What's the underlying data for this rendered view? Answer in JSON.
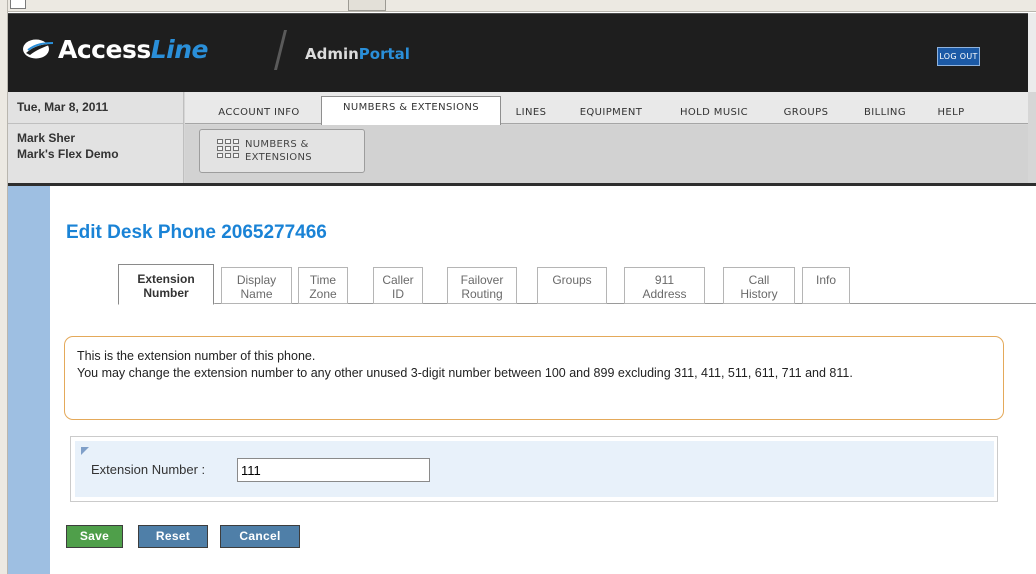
{
  "header": {
    "logo_access": "Access",
    "logo_line": "Line",
    "portal_admin": "Admin",
    "portal_portal": "Portal",
    "logout_label": "LOG OUT"
  },
  "account": {
    "date": "Tue, Mar 8, 2011",
    "user_name": "Mark Sher",
    "account_name": "Mark's Flex Demo"
  },
  "nav": {
    "tabs": [
      {
        "label": "ACCOUNT INFO"
      },
      {
        "label": "NUMBERS & EXTENSIONS",
        "active": true
      },
      {
        "label": "LINES"
      },
      {
        "label": "EQUIPMENT"
      },
      {
        "label": "HOLD MUSIC"
      },
      {
        "label": "GROUPS"
      },
      {
        "label": "BILLING"
      },
      {
        "label": "HELP"
      }
    ],
    "subnav_line1": "NUMBERS &",
    "subnav_line2": "EXTENSIONS"
  },
  "page": {
    "title": "Edit Desk Phone 2065277466",
    "tabs": [
      {
        "line1": "Extension",
        "line2": "Number",
        "active": true
      },
      {
        "line1": "Display",
        "line2": "Name"
      },
      {
        "line1": "Time",
        "line2": "Zone"
      },
      {
        "line1": "Caller",
        "line2": "ID"
      },
      {
        "line1": "Failover",
        "line2": "Routing"
      },
      {
        "line1": "Groups",
        "line2": ""
      },
      {
        "line1": "911",
        "line2": "Address"
      },
      {
        "line1": "Call",
        "line2": "History"
      },
      {
        "line1": "Info",
        "line2": ""
      }
    ],
    "info_line1": "This is the extension number of this phone.",
    "info_line2": "You may change the extension number to any other unused 3-digit number between 100 and 899 excluding 311, 411, 511, 611, 711 and 811.",
    "field_label": "Extension Number :",
    "field_value": "111"
  },
  "buttons": {
    "save": "Save",
    "reset": "Reset",
    "cancel": "Cancel"
  },
  "colors": {
    "brand_blue": "#1a83d6",
    "header_bg": "#1e1e1e",
    "info_border": "#e4a95a",
    "save_green": "#4f9f4a",
    "button_blue": "#4f7fa8",
    "sidebar_blue": "#9ebfe2"
  }
}
